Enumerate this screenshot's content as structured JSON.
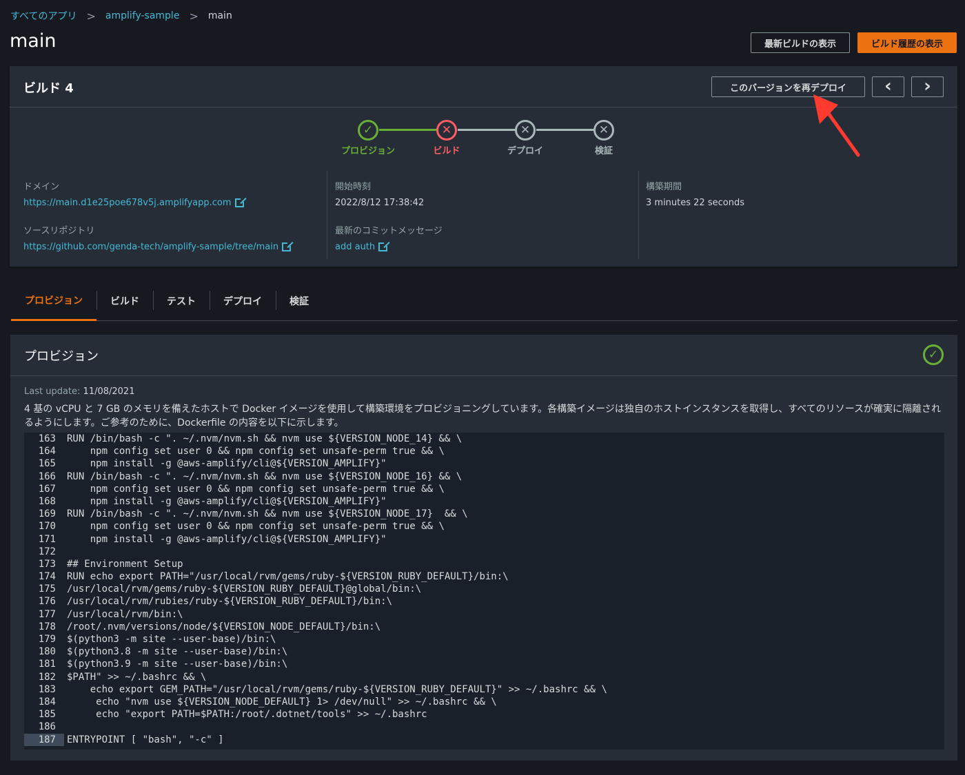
{
  "breadcrumb": {
    "all_apps": "すべてのアプリ",
    "app": "amplify-sample",
    "current": "main"
  },
  "page_title": "main",
  "top_actions": {
    "latest_build": "最新ビルドの表示",
    "build_history": "ビルド履歴の表示"
  },
  "build": {
    "title": "ビルド 4",
    "redeploy": "このバージョンを再デプロイ",
    "prev_icon": "‹",
    "next_icon": "›",
    "steps": [
      {
        "label": "プロビジョン",
        "status": "success",
        "icon": "✓"
      },
      {
        "label": "ビルド",
        "status": "failed",
        "icon": "✕"
      },
      {
        "label": "デプロイ",
        "status": "skipped",
        "icon": "✕"
      },
      {
        "label": "検証",
        "status": "skipped",
        "icon": "✕"
      }
    ],
    "domain_label": "ドメイン",
    "domain_url": "https://main.d1e25poe678v5j.amplifyapp.com",
    "repo_label": "ソースリポジトリ",
    "repo_url": "https://github.com/genda-tech/amplify-sample/tree/main",
    "start_label": "開始時刻",
    "start_time": "2022/8/12 17:38:42",
    "commit_label": "最新のコミットメッセージ",
    "commit_message": "add auth",
    "duration_label": "構築期間",
    "duration": "3 minutes 22 seconds"
  },
  "tabs": [
    "プロビジョン",
    "ビルド",
    "テスト",
    "デプロイ",
    "検証"
  ],
  "provision": {
    "title": "プロビジョン",
    "last_update_label": "Last update:",
    "last_update": "11/08/2021",
    "description": "4 基の vCPU と 7 GB のメモリを備えたホストで Docker イメージを使用して構築環境をプロビジョニングしています。各構築イメージは独自のホストインスタンスを取得し、すべてのリソースが確実に隔離されるようにします。ご参考のために、Dockerfile の内容を以下に示します。",
    "code": [
      {
        "n": "163",
        "t": "RUN /bin/bash -c \". ~/.nvm/nvm.sh && nvm use ${VERSION_NODE_14} && \\"
      },
      {
        "n": "164",
        "t": "    npm config set user 0 && npm config set unsafe-perm true && \\"
      },
      {
        "n": "165",
        "t": "    npm install -g @aws-amplify/cli@${VERSION_AMPLIFY}\""
      },
      {
        "n": "166",
        "t": "RUN /bin/bash -c \". ~/.nvm/nvm.sh && nvm use ${VERSION_NODE_16} && \\"
      },
      {
        "n": "167",
        "t": "    npm config set user 0 && npm config set unsafe-perm true && \\"
      },
      {
        "n": "168",
        "t": "    npm install -g @aws-amplify/cli@${VERSION_AMPLIFY}\""
      },
      {
        "n": "169",
        "t": "RUN /bin/bash -c \". ~/.nvm/nvm.sh && nvm use ${VERSION_NODE_17}  && \\"
      },
      {
        "n": "170",
        "t": "    npm config set user 0 && npm config set unsafe-perm true && \\"
      },
      {
        "n": "171",
        "t": "    npm install -g @aws-amplify/cli@${VERSION_AMPLIFY}\""
      },
      {
        "n": "172",
        "t": ""
      },
      {
        "n": "173",
        "t": "## Environment Setup"
      },
      {
        "n": "174",
        "t": "RUN echo export PATH=\"/usr/local/rvm/gems/ruby-${VERSION_RUBY_DEFAULT}/bin:\\"
      },
      {
        "n": "175",
        "t": "/usr/local/rvm/gems/ruby-${VERSION_RUBY_DEFAULT}@global/bin:\\"
      },
      {
        "n": "176",
        "t": "/usr/local/rvm/rubies/ruby-${VERSION_RUBY_DEFAULT}/bin:\\"
      },
      {
        "n": "177",
        "t": "/usr/local/rvm/bin:\\"
      },
      {
        "n": "178",
        "t": "/root/.nvm/versions/node/${VERSION_NODE_DEFAULT}/bin:\\"
      },
      {
        "n": "179",
        "t": "$(python3 -m site --user-base)/bin:\\"
      },
      {
        "n": "180",
        "t": "$(python3.8 -m site --user-base)/bin:\\"
      },
      {
        "n": "181",
        "t": "$(python3.9 -m site --user-base)/bin:\\"
      },
      {
        "n": "182",
        "t": "$PATH\" >> ~/.bashrc && \\"
      },
      {
        "n": "183",
        "t": "    echo export GEM_PATH=\"/usr/local/rvm/gems/ruby-${VERSION_RUBY_DEFAULT}\" >> ~/.bashrc && \\"
      },
      {
        "n": "184",
        "t": "     echo \"nvm use ${VERSION_NODE_DEFAULT} 1> /dev/null\" >> ~/.bashrc && \\"
      },
      {
        "n": "185",
        "t": "     echo \"export PATH=$PATH:/root/.dotnet/tools\" >> ~/.bashrc"
      },
      {
        "n": "186",
        "t": ""
      },
      {
        "n": "187",
        "t": "ENTRYPOINT [ \"bash\", \"-c\" ]"
      }
    ]
  }
}
